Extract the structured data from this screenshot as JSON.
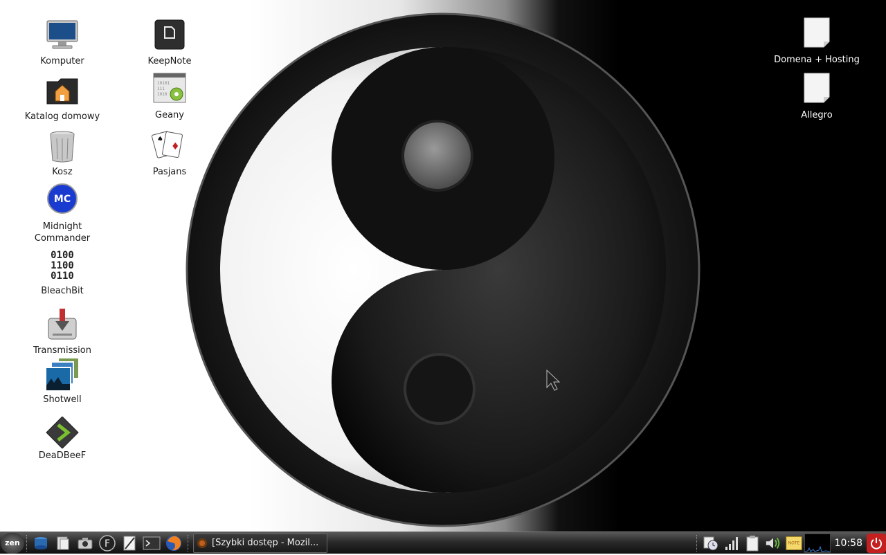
{
  "desktop": {
    "left_icons": [
      {
        "label": "Komputer",
        "icon": "computer-icon"
      },
      {
        "label": "Katalog domowy",
        "icon": "home-folder-icon"
      },
      {
        "label": "Kosz",
        "icon": "trash-icon"
      },
      {
        "label": "Midnight Commander",
        "icon": "midnight-commander-icon",
        "badge": "MC"
      },
      {
        "label": "BleachBit",
        "icon": "bleachbit-icon",
        "lines": [
          "0100",
          "1100",
          "0110"
        ]
      },
      {
        "label": "Transmission",
        "icon": "transmission-icon"
      },
      {
        "label": "Shotwell",
        "icon": "shotwell-icon"
      },
      {
        "label": "DeaDBeeF",
        "icon": "deadbeef-icon"
      }
    ],
    "second_column_icons": [
      {
        "label": "KeepNote",
        "icon": "keepnote-icon"
      },
      {
        "label": "Geany",
        "icon": "geany-icon"
      },
      {
        "label": "Pasjans",
        "icon": "solitaire-icon"
      }
    ],
    "right_icons": [
      {
        "label": "Domena + Hosting",
        "icon": "document-icon"
      },
      {
        "label": "Allegro",
        "icon": "document-icon"
      }
    ]
  },
  "taskbar": {
    "start_label": "zen",
    "launchers": [
      "database-icon",
      "file-manager-icon",
      "camera-icon",
      "font-icon",
      "text-editor-icon",
      "terminal-icon",
      "firefox-icon"
    ],
    "task": {
      "label": "[Szybki dostęp - Mozil...",
      "icon": "firefox-icon"
    },
    "tray": [
      "clock-applet-icon",
      "signal-icon",
      "clipboard-icon",
      "volume-icon",
      "note-icon"
    ],
    "note_label": "NOTE",
    "clock": "10:58"
  },
  "colors": {
    "power": "#c42020",
    "taskbar": "#222222"
  }
}
